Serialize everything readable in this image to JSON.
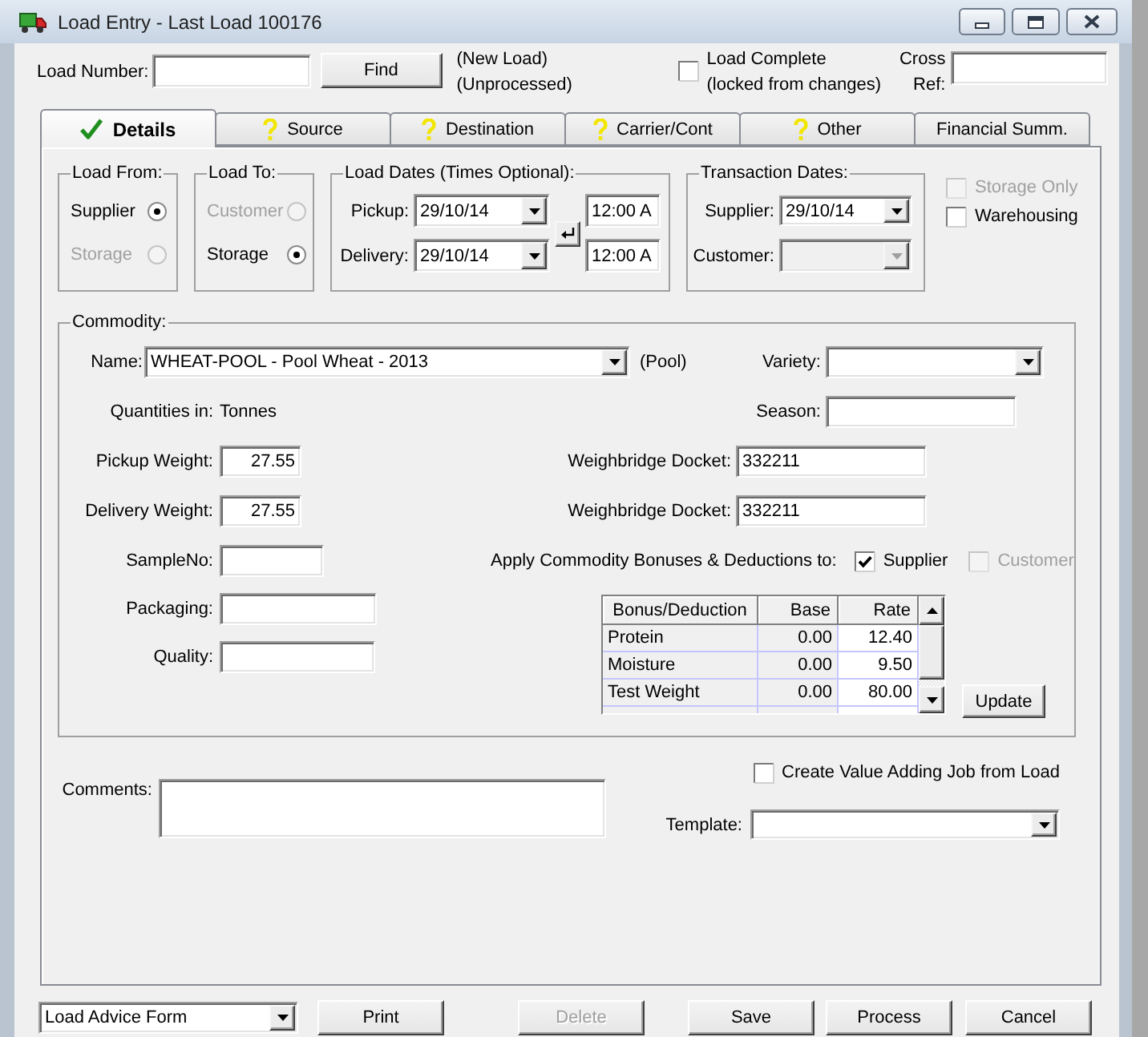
{
  "window": {
    "title": "Load Entry - Last Load 100176"
  },
  "header": {
    "load_number": {
      "label": "Load Number:"
    },
    "find_button": "Find",
    "status_lines": [
      "(New Load)",
      "(Unprocessed)"
    ],
    "load_complete": {
      "label_lines": [
        "Load Complete",
        "(locked from changes)"
      ],
      "checked": false
    },
    "cross_ref": {
      "label_lines": [
        "Cross",
        "Ref:"
      ]
    }
  },
  "tabs": [
    {
      "label": "Details",
      "kind": "done",
      "selected": true
    },
    {
      "label": "Source",
      "kind": "pending",
      "selected": false
    },
    {
      "label": "Destination",
      "kind": "pending",
      "selected": false
    },
    {
      "label": "Carrier/Cont",
      "kind": "pending",
      "selected": false
    },
    {
      "label": "Other",
      "kind": "pending",
      "selected": false
    },
    {
      "label": "Financial Summ.",
      "kind": "plain",
      "selected": false
    }
  ],
  "load_from": {
    "title": "Load From:",
    "options": [
      {
        "label": "Supplier",
        "selected": true,
        "disabled": false
      },
      {
        "label": "Storage",
        "selected": false,
        "disabled": true
      }
    ]
  },
  "load_to": {
    "title": "Load To:",
    "options": [
      {
        "label": "Customer",
        "selected": false,
        "disabled": true
      },
      {
        "label": "Storage",
        "selected": true,
        "disabled": false
      }
    ]
  },
  "load_dates": {
    "title": "Load Dates (Times Optional):",
    "rows": [
      {
        "label": "Pickup:",
        "date": "29/10/14",
        "time": "12:00 A"
      },
      {
        "label": "Delivery:",
        "date": "29/10/14",
        "time": "12:00 A"
      }
    ]
  },
  "transaction_dates": {
    "title": "Transaction Dates:",
    "rows": [
      {
        "label": "Supplier:",
        "date": "29/10/14",
        "disabled": false
      },
      {
        "label": "Customer:",
        "disabled": true
      }
    ]
  },
  "storage_options": [
    {
      "label": "Storage Only",
      "checked": false,
      "disabled": true
    },
    {
      "label": "Warehousing",
      "checked": false,
      "disabled": false
    }
  ],
  "commodity": {
    "title": "Commodity:",
    "name": {
      "label": "Name:",
      "value": "WHEAT-POOL - Pool Wheat - 2013",
      "note": "(Pool)"
    },
    "variety": {
      "label": "Variety:"
    },
    "quantities": {
      "label": "Quantities in:",
      "value": "Tonnes"
    },
    "season": {
      "label": "Season:"
    },
    "weights": [
      {
        "label": "Pickup Weight:",
        "value": "27.55",
        "docket_label": "Weighbridge Docket:",
        "docket": "332211"
      },
      {
        "label": "Delivery Weight:",
        "value": "27.55",
        "docket_label": "Weighbridge Docket:",
        "docket": "332211"
      }
    ],
    "sample_no": {
      "label": "SampleNo:"
    },
    "apply_bonuses": {
      "label": "Apply Commodity Bonuses & Deductions to:",
      "targets": [
        {
          "label": "Supplier",
          "checked": true,
          "disabled": false
        },
        {
          "label": "Customer",
          "checked": false,
          "disabled": true
        }
      ]
    },
    "packaging": {
      "label": "Packaging:"
    },
    "quality": {
      "label": "Quality:"
    },
    "bonus_table": {
      "columns": [
        "Bonus/Deduction",
        "Base",
        "Rate"
      ],
      "rows": [
        [
          "Protein",
          "0.00",
          "12.40"
        ],
        [
          "Moisture",
          "0.00",
          "9.50"
        ],
        [
          "Test Weight",
          "0.00",
          "80.00"
        ]
      ]
    },
    "update_button": "Update"
  },
  "comments": {
    "label": "Comments:"
  },
  "value_adding_job": {
    "label": "Create Value Adding Job from Load",
    "checked": false
  },
  "template": {
    "label": "Template:"
  },
  "footer": {
    "report": "Load Advice Form",
    "buttons": [
      {
        "label": "Print",
        "disabled": false
      },
      {
        "label": "Delete",
        "disabled": true
      },
      {
        "label": "Save",
        "disabled": false
      },
      {
        "label": "Process",
        "disabled": false
      },
      {
        "label": "Cancel",
        "disabled": false
      }
    ]
  }
}
